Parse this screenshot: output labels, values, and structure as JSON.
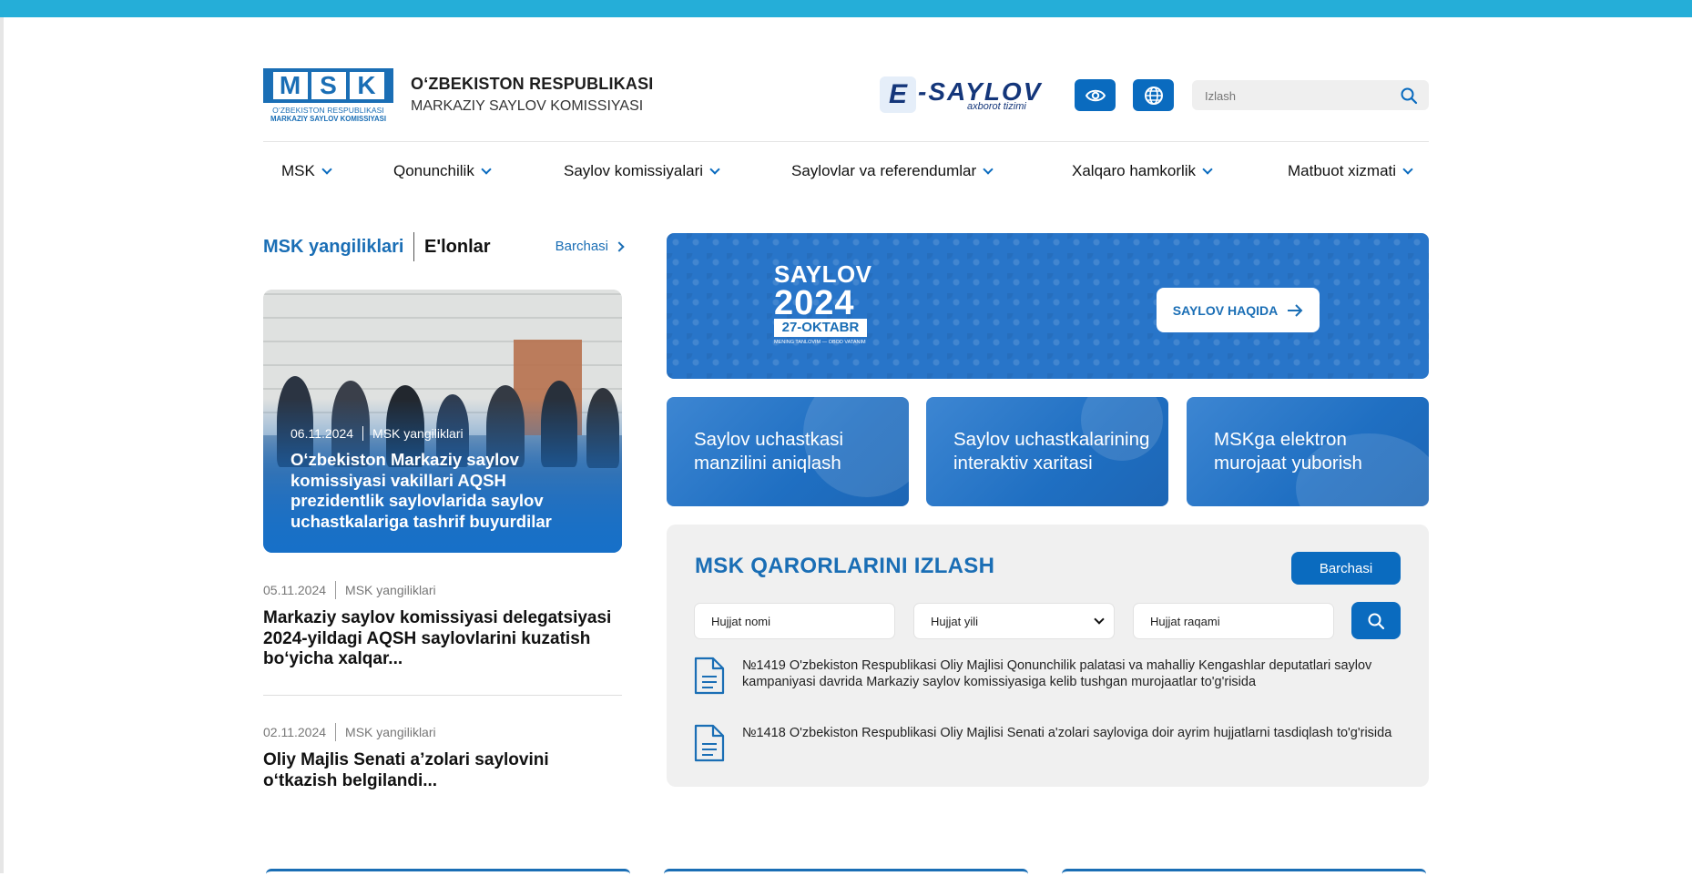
{
  "header": {
    "logo_letters": [
      "M",
      "S",
      "K"
    ],
    "logo_sub1": "O‘ZBEKISTON RESPUBLIKASI",
    "logo_sub2": "MARKAZIY SAYLOV KOMISSIYASI",
    "org_line1": "O‘ZBEKISTON RESPUBLIKASI",
    "org_line2": "MARKAZIY SAYLOV KOMISSIYASI",
    "esaylov_e": "E",
    "esaylov_word": "-SAYLOV",
    "esaylov_sub": "axborot tizimi",
    "search_placeholder": "Izlash"
  },
  "nav": {
    "items": [
      {
        "label": "MSK"
      },
      {
        "label": "Qonunchilik"
      },
      {
        "label": "Saylov komissiyalari"
      },
      {
        "label": "Saylovlar va referendumlar"
      },
      {
        "label": "Xalqaro hamkorlik"
      },
      {
        "label": "Matbuot xizmati"
      }
    ]
  },
  "news": {
    "tab_active": "MSK yangiliklari",
    "tab_other": "E'lonlar",
    "all_link": "Barchasi",
    "featured": {
      "date": "06.11.2024",
      "category": "MSK yangiliklari",
      "title": "O‘zbekiston Markaziy saylov komissiyasi vakillari AQSH prezidentlik saylovlarida saylov uchastkalariga tashrif buyurdilar"
    },
    "items": [
      {
        "date": "05.11.2024",
        "category": "MSK yangiliklari",
        "title": "Markaziy saylov komissiyasi delegatsiyasi 2024-yildagi AQSH saylovlarini kuzatish bo‘yicha xalqar..."
      },
      {
        "date": "02.11.2024",
        "category": "MSK yangiliklari",
        "title": "Oliy Majlis Senati a’zolari saylovini o‘tkazish belgilandi..."
      }
    ]
  },
  "banner": {
    "line1": "SAYLOV",
    "line2": "2024",
    "date": "27-OKTABR",
    "small": "MENING TANLOVIM — OBOD VATANIM",
    "button": "SAYLOV HAQIDA"
  },
  "cards": [
    {
      "label": "Saylov uchastkasi manzilini aniqlash"
    },
    {
      "label": "Saylov uchastkalarining interaktiv xaritasi"
    },
    {
      "label": "MSKga elektron murojaat yuborish"
    }
  ],
  "decisions": {
    "title": "MSK QARORLARINI IZLASH",
    "all_button": "Barchasi",
    "doc_name_placeholder": "Hujjat nomi",
    "doc_year_selected": "Hujjat yili",
    "doc_number_placeholder": "Hujjat raqami",
    "docs": [
      {
        "title": "№1419 O'zbekiston Respublikasi Oliy Majlisi Qonunchilik palatasi va mahalliy Kengashlar deputatlari saylov kampaniyasi davrida Markaziy saylov komissiyasiga kelib tushgan murojaatlar to'g'risida"
      },
      {
        "title": "№1418 O'zbekiston Respublikasi Oliy Majlisi Senati a'zolari sayloviga doir ayrim hujjatlarni tasdiqlash to'g'risida"
      }
    ]
  },
  "colors": {
    "accent": "#0a6bbf",
    "topbar": "#25aed8",
    "brand_dark": "#14367a"
  }
}
